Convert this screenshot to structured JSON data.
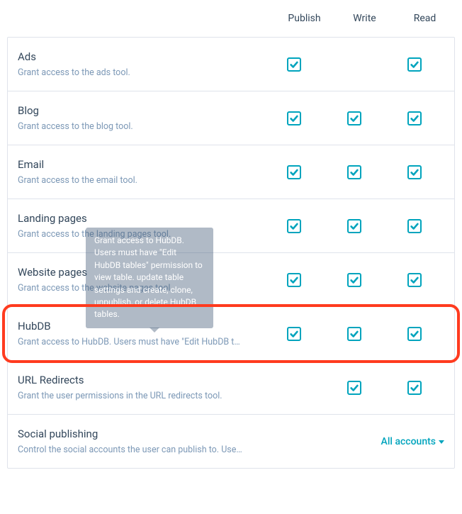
{
  "columns": {
    "publish": "Publish",
    "write": "Write",
    "read": "Read"
  },
  "rows": [
    {
      "title": "Ads",
      "desc": "Grant access to the ads tool.",
      "checks": {
        "publish": true,
        "write": false,
        "read": true
      }
    },
    {
      "title": "Blog",
      "desc": "Grant access to the blog tool.",
      "checks": {
        "publish": true,
        "write": true,
        "read": true
      }
    },
    {
      "title": "Email",
      "desc": "Grant access to the email tool.",
      "checks": {
        "publish": true,
        "write": true,
        "read": true
      }
    },
    {
      "title": "Landing pages",
      "desc": "Grant access to the landing pages tool.",
      "checks": {
        "publish": true,
        "write": true,
        "read": true
      }
    },
    {
      "title": "Website pages",
      "desc": "Grant access to the website pages tool.",
      "checks": {
        "publish": true,
        "write": true,
        "read": true
      }
    },
    {
      "title": "HubDB",
      "desc": "Grant access to HubDB. Users must have \"Edit HubDB ta…",
      "checks": {
        "publish": true,
        "write": true,
        "read": true
      },
      "highlighted": true,
      "tooltip": "Grant access to HubDB. Users must have \"Edit HubDB tables\" permission to view table. update table settings and create, clone, unpublish, or delete HubDB tables."
    },
    {
      "title": "URL Redirects",
      "desc": "Grant the user permissions in the URL redirects tool.",
      "checks": {
        "publish": false,
        "write": true,
        "read": true
      }
    },
    {
      "title": "Social publishing",
      "desc": "Control the social accounts the user can publish to. User…",
      "dropdown": "All accounts"
    }
  ]
}
